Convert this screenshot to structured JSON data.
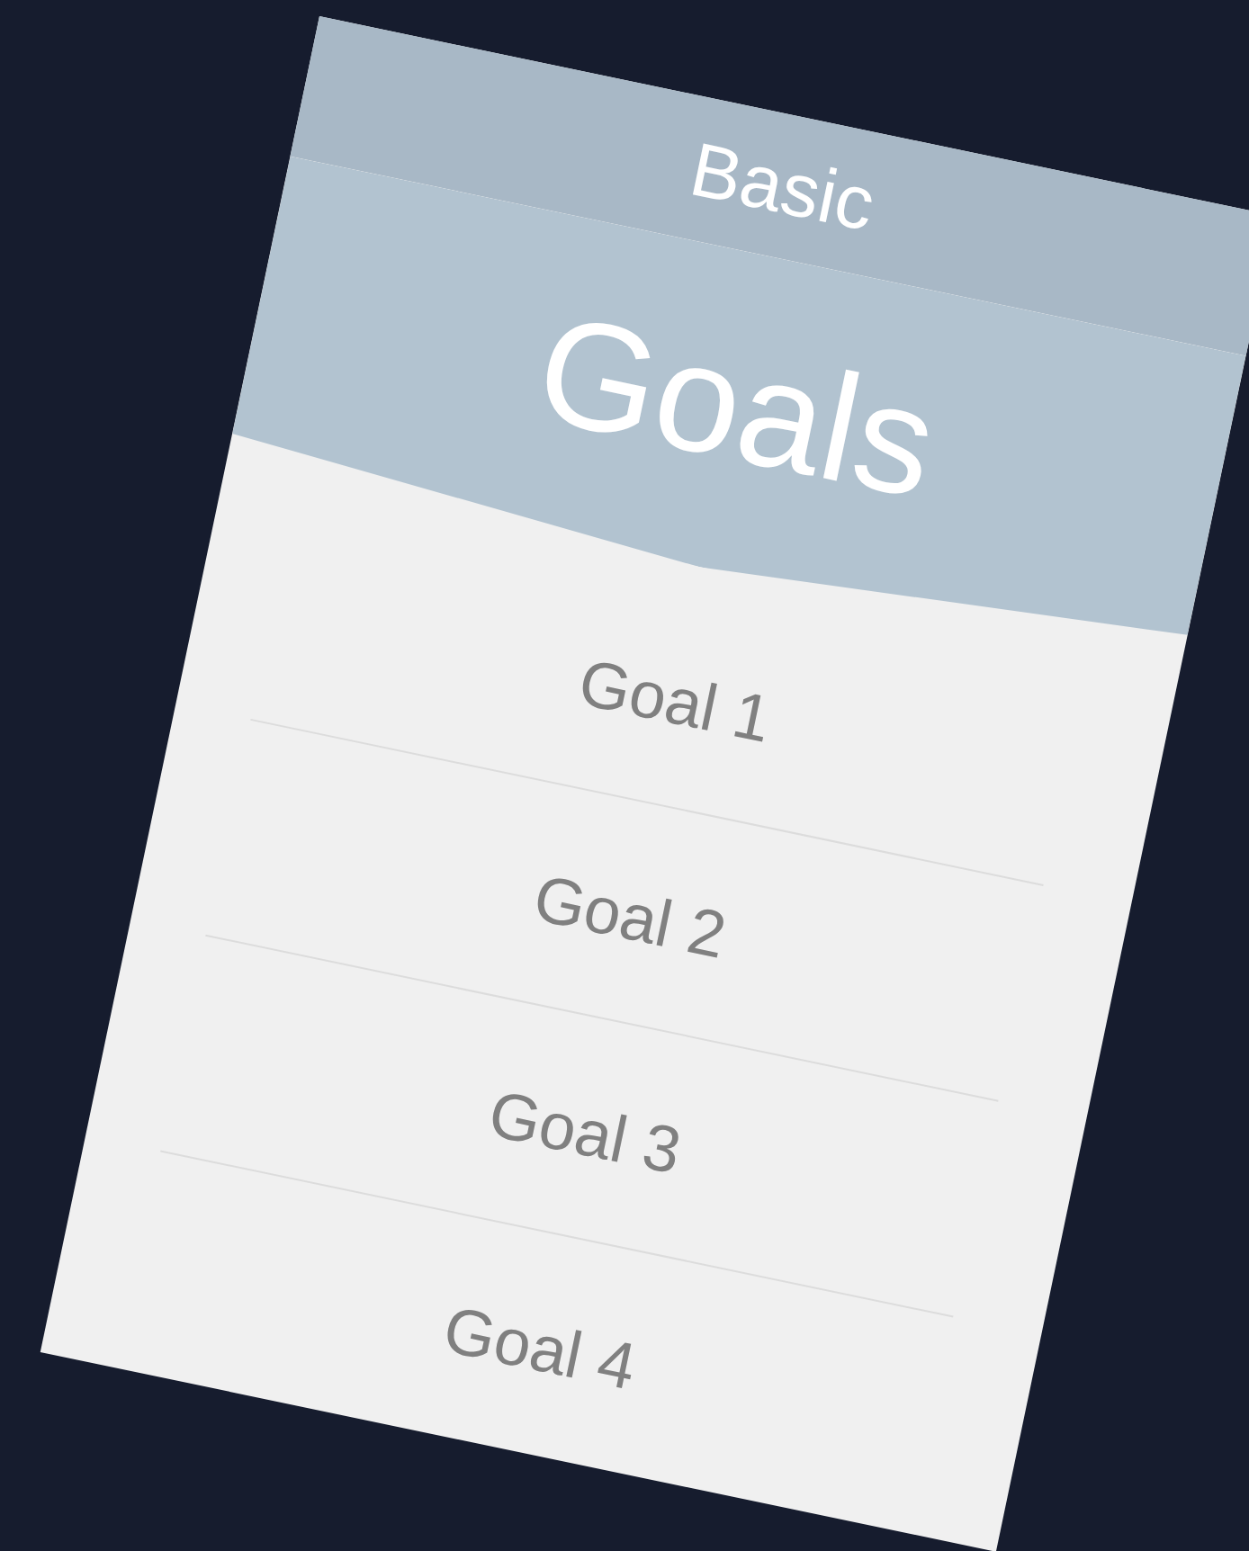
{
  "header": {
    "subtitle": "Basic",
    "title": "Goals"
  },
  "goals": [
    {
      "label": "Goal 1"
    },
    {
      "label": "Goal 2"
    },
    {
      "label": "Goal 3"
    },
    {
      "label": "Goal 4"
    }
  ]
}
